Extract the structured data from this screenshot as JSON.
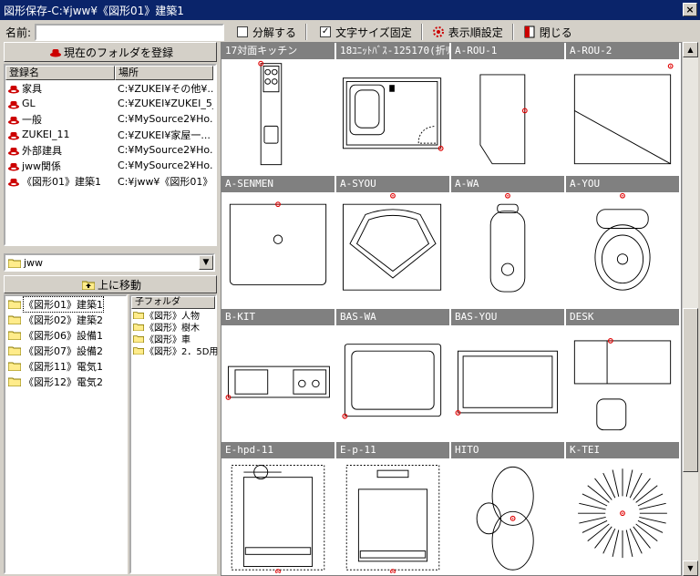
{
  "window": {
    "title": "図形保存-C:¥jww¥《図形01》建築1",
    "close": "×"
  },
  "toolbar": {
    "name_label": "名前:",
    "name_value": "",
    "decompose_label": "分解する",
    "decompose_checked": false,
    "fix_text_size_label": "文字サイズ固定",
    "fix_text_size_checked": true,
    "display_order_label": "表示順設定",
    "close_label": "閉じる"
  },
  "left": {
    "register_button": "現在のフォルダを登録",
    "columns": [
      "登録名",
      "場所"
    ],
    "registered": [
      {
        "name": "家具",
        "path": "C:¥ZUKEI¥その他¥..."
      },
      {
        "name": "GL",
        "path": "C:¥ZUKEI¥ZUKEI_5_"
      },
      {
        "name": "一般",
        "path": "C:¥MySource2¥Ho..."
      },
      {
        "name": "ZUKEI_11",
        "path": "C:¥ZUKEI¥家屋一..."
      },
      {
        "name": "外部建具",
        "path": "C:¥MySource2¥Ho..."
      },
      {
        "name": "jww関係",
        "path": "C:¥MySource2¥Ho..."
      },
      {
        "name": "《図形01》建築1",
        "path": "C:¥jww¥《図形01》..."
      }
    ],
    "drive_value": "jww",
    "up_button": "上に移動",
    "folders": [
      "《図形01》建築1",
      "《図形02》建築2",
      "《図形06》設備1",
      "《図形07》設備2",
      "《図形11》電気1",
      "《図形12》電気2"
    ],
    "selected_folder": 0,
    "subfolder_header": "子フォルダ",
    "subfolders": [
      "《図形》人物",
      "《図形》樹木",
      "《図形》車",
      "《図形》2．5D用"
    ]
  },
  "grid": {
    "items": [
      {
        "label": "17対面キッチン",
        "icon": "kitchen"
      },
      {
        "label": "18ﾕﾆｯﾄﾊﾞｽ-125170(折ﾘ",
        "icon": "unitbath"
      },
      {
        "label": "A-ROU-1",
        "icon": "rou1"
      },
      {
        "label": "A-ROU-2",
        "icon": "rou2"
      },
      {
        "label": "A-SENMEN",
        "icon": "senmen"
      },
      {
        "label": "A-SYOU",
        "icon": "syou"
      },
      {
        "label": "A-WA",
        "icon": "wa"
      },
      {
        "label": "A-YOU",
        "icon": "you"
      },
      {
        "label": "B-KIT",
        "icon": "bkit"
      },
      {
        "label": "BAS-WA",
        "icon": "baswa"
      },
      {
        "label": "BAS-YOU",
        "icon": "basyou"
      },
      {
        "label": "DESK",
        "icon": "desk"
      },
      {
        "label": "E-hpd-11",
        "icon": "ehpd"
      },
      {
        "label": "E-p-11",
        "icon": "ep"
      },
      {
        "label": "HITO",
        "icon": "hito"
      },
      {
        "label": "K-TEI",
        "icon": "ktei"
      }
    ]
  },
  "colors": {
    "titlebar": "#0a246a",
    "caption": "#808080",
    "point": "#e00000"
  }
}
